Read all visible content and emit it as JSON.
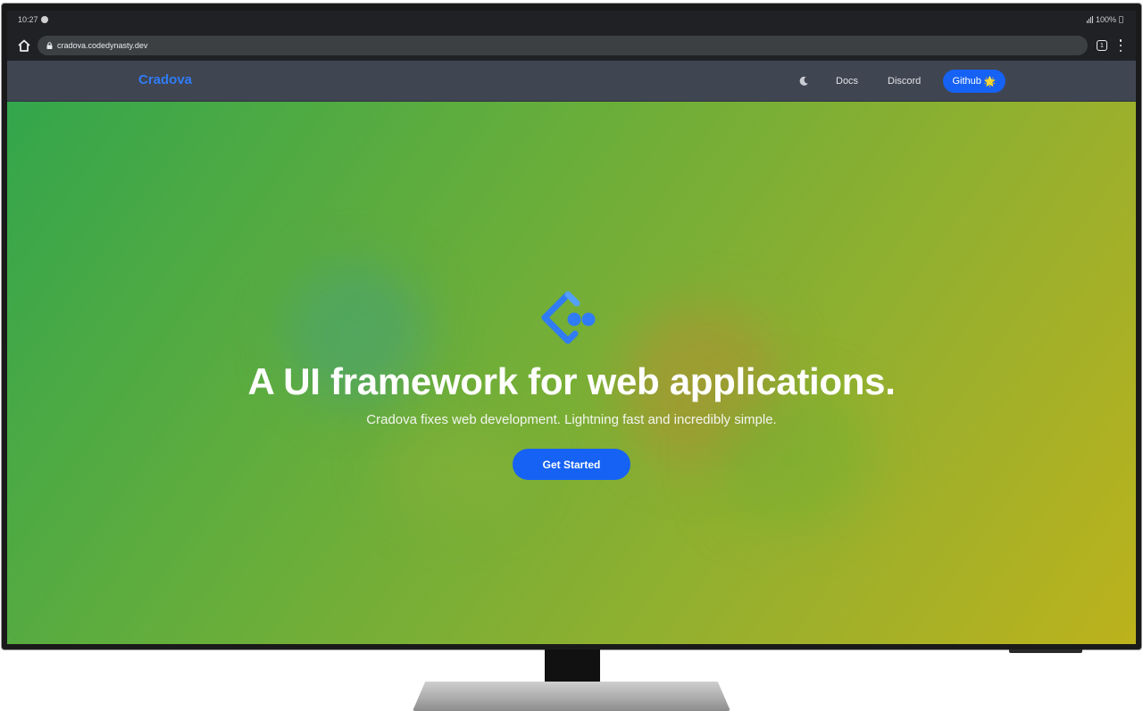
{
  "statusbar": {
    "time": "10:27",
    "battery_text": "100%"
  },
  "browser": {
    "url": "cradova.codedynasty.dev",
    "tab_count": "1"
  },
  "nav": {
    "brand": "Cradova",
    "links": [
      "Docs",
      "Discord"
    ],
    "github_label": "Github",
    "github_emoji": "🌟",
    "brand_color": "#2f7cf6",
    "button_color": "#1662f5"
  },
  "hero": {
    "headline": "A UI framework for web applications.",
    "tagline": "Cradova fixes web development. Lightning fast and incredibly simple.",
    "cta_label": "Get Started"
  }
}
